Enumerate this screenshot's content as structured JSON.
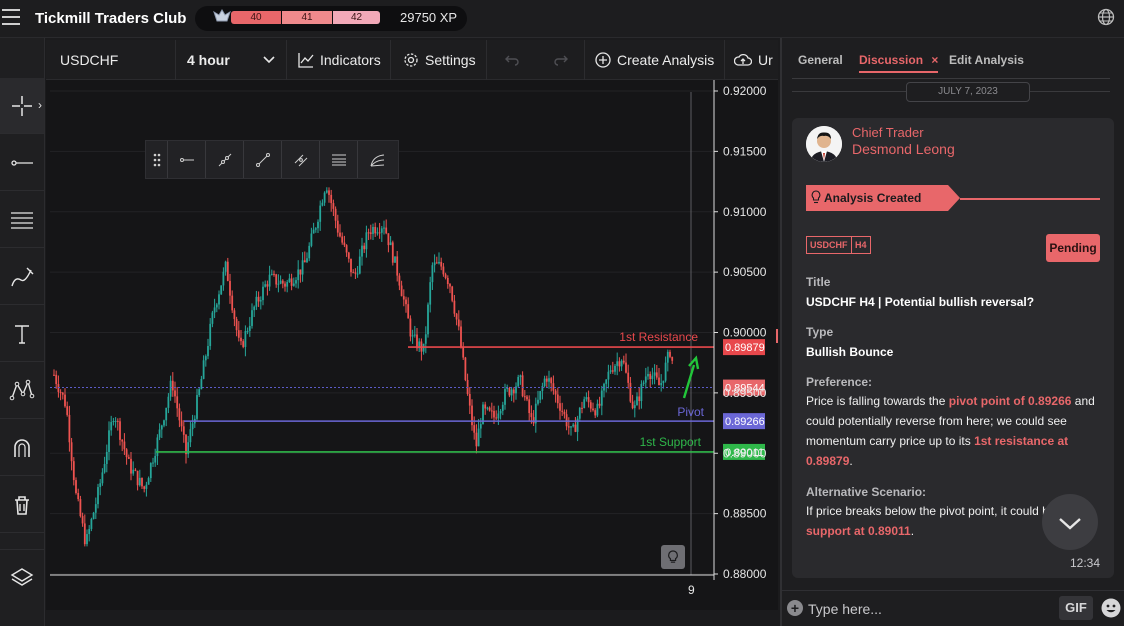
{
  "app": {
    "title": "Tickmill Traders Club"
  },
  "xp_bar": {
    "segments": [
      "40",
      "41",
      "42"
    ],
    "xp_text": "29750 XP"
  },
  "toolbar": {
    "symbol": "USDCHF",
    "timeframe": "4 hour",
    "indicators_label": "Indicators",
    "settings_label": "Settings",
    "create_analysis_label": "Create Analysis",
    "upload_label": "Ur"
  },
  "chart": {
    "y_ticks": [
      "0.92000",
      "0.91500",
      "0.91000",
      "0.90500",
      "0.90000",
      "0.89500",
      "0.89000",
      "0.88500",
      "0.88000"
    ],
    "x_ticks": [
      "9"
    ],
    "levels": [
      {
        "name": "1st Resistance",
        "price": 0.89879,
        "price_label": "0.89879",
        "color": "#e8484c"
      },
      {
        "name": "Pivot",
        "price": 0.89266,
        "price_label": "0.89266",
        "color": "#6b67d6"
      },
      {
        "name": "1st Support",
        "price": 0.89011,
        "price_label": "0.89011",
        "color": "#2fb84a"
      }
    ],
    "current_price": {
      "price": 0.89544,
      "label": "0.89544",
      "color": "#e8676a"
    },
    "colors": {
      "up": "#26a69a",
      "down": "#ef5350",
      "background": "#151517"
    }
  },
  "panel": {
    "tabs": [
      "General",
      "Discussion",
      "Edit Analysis"
    ],
    "active_tab": "Discussion",
    "date": "JULY 7, 2023",
    "author_role": "Chief Trader",
    "author_name": "Desmond Leong",
    "status_banner": "Analysis Created",
    "tags": [
      "USDCHF",
      "H4"
    ],
    "status": "Pending",
    "title_label": "Title",
    "title_value": "USDCHF H4 | Potential bullish reversal?",
    "type_label": "Type",
    "type_value": "Bullish Bounce",
    "preference_label": "Preference:",
    "preference_text": {
      "p1": "Price is falling towards the ",
      "h1": "pivot point of 0.89266",
      "p2": " and could potentially reverse from here; we could see momentum carry price up to its ",
      "h2": "1st resistance at 0.89879",
      "p3": "."
    },
    "alternative_label": "Alternative Scenario:",
    "alternative_text": {
      "p1": "If price breaks below the pivot point, it could h",
      "h1": "support at 0.89011",
      "p2": "."
    },
    "time": "12:34",
    "composer_placeholder": "Type here...",
    "gif_label": "GIF"
  }
}
